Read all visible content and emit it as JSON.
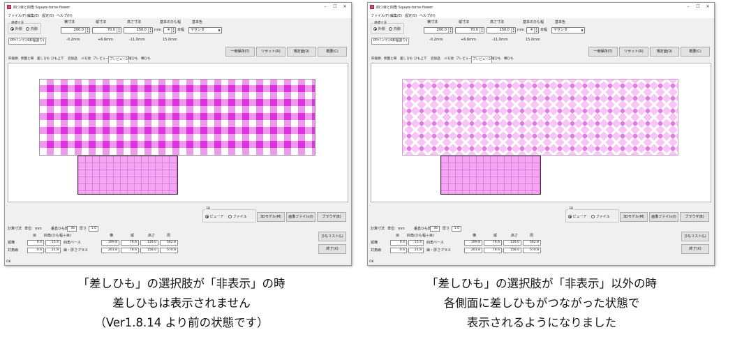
{
  "window": {
    "title": "四つ目と四角 Square-tomo-flower",
    "controls": [
      "–",
      "☐",
      "✕"
    ],
    "menu": [
      "ファイル(F)",
      "編集(E)",
      "設定(S)",
      "ヘルプ(H)"
    ]
  },
  "target": {
    "group_label": "目標寸法",
    "outer": "外側",
    "inner": "内側",
    "band_label": "PPバンド(4本幅割り)"
  },
  "dims": {
    "width_label": "横寸法",
    "depth_label": "縦寸法",
    "height_label": "高さ寸法",
    "unit": "mm",
    "base_band_label": "基本のひも幅",
    "band_unit": "本幅",
    "base_color_label": "基本色",
    "width_value": "200.0",
    "depth_value": "70.0",
    "height_value": "150.0",
    "band_value": "4",
    "color_value": "マゼンタ",
    "diff_width": "-0.2mm",
    "diff_depth": "+6.6mm",
    "diff_height": "-11.0mm",
    "diff_band": "15.0mm"
  },
  "buttons": {
    "temp_save": "一時保存(T)",
    "reset": "リセット(R)",
    "default": "規定値(D)",
    "summary": "概要(C)",
    "model3d": "3Dモデル(M)",
    "image_file": "画像ファイル(I)",
    "browser": "ブラウザ(B)",
    "band_list": "ひもリスト(L)",
    "finish": "終了(X)"
  },
  "tabs": [
    "四角数",
    "側面と縁",
    "差しひも",
    "ひも上下",
    "追加品",
    "メモ他",
    "プレビュー",
    "プレビュー2",
    "縦ひも",
    "横ひも"
  ],
  "output_3d": {
    "label": "3D",
    "viewer": "ビューア",
    "file": "ファイル"
  },
  "measure": {
    "label": "計算寸法",
    "unit_label": "単位:",
    "unit": "mm",
    "vertical_count_label": "垂直ひも数",
    "vertical_count": "36",
    "thickness_label": "厚さ",
    "thickness": "1.0"
  },
  "table": {
    "header": [
      "目",
      "四角(ひも幅＋目)",
      "横",
      "縦",
      "高さ",
      "周"
    ],
    "rows": [
      {
        "label": "縦横",
        "c1": "0.4",
        "c2": "15.4",
        "sublabel": "四角ベース",
        "w": "199.8",
        "d": "76.6",
        "h": "139.0",
        "p": "562.8"
      },
      {
        "label": "対角線",
        "c1": "0.6",
        "c2": "21.8",
        "sublabel": "縁・厚さプラス",
        "w": "201.8",
        "d": "78.6",
        "h": "158.0",
        "p": "570.8"
      }
    ]
  },
  "status": "OK",
  "captions": {
    "left": [
      "「差しひも」の選択肢が「非表示」の時",
      "差しひもは表示されません",
      "（Ver1.8.14 より前の状態です）"
    ],
    "right": [
      "「差しひも」の選択肢が「非表示」以外の時",
      "各側面に差しひもがつながった状態で",
      "表示されるようになりました"
    ]
  }
}
